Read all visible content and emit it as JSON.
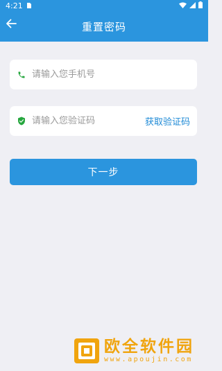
{
  "status_bar": {
    "time": "4:21"
  },
  "nav": {
    "title": "重置密码"
  },
  "phone_field": {
    "placeholder": "请输入您手机号",
    "value": ""
  },
  "code_field": {
    "placeholder": "请输入您验证码",
    "value": "",
    "get_code_label": "获取验证码"
  },
  "next_button": {
    "label": "下一步"
  },
  "watermark": {
    "title": "欧全软件园",
    "url": "www.apoujin.com"
  },
  "colors": {
    "primary": "#2b95de",
    "icon_green": "#27a73f",
    "link": "#1f8ad6",
    "watermark": "#f0a40e"
  },
  "icons": [
    "back-arrow-icon",
    "phone-icon",
    "shield-check-icon",
    "wifi-icon",
    "signal-icon",
    "battery-icon"
  ]
}
